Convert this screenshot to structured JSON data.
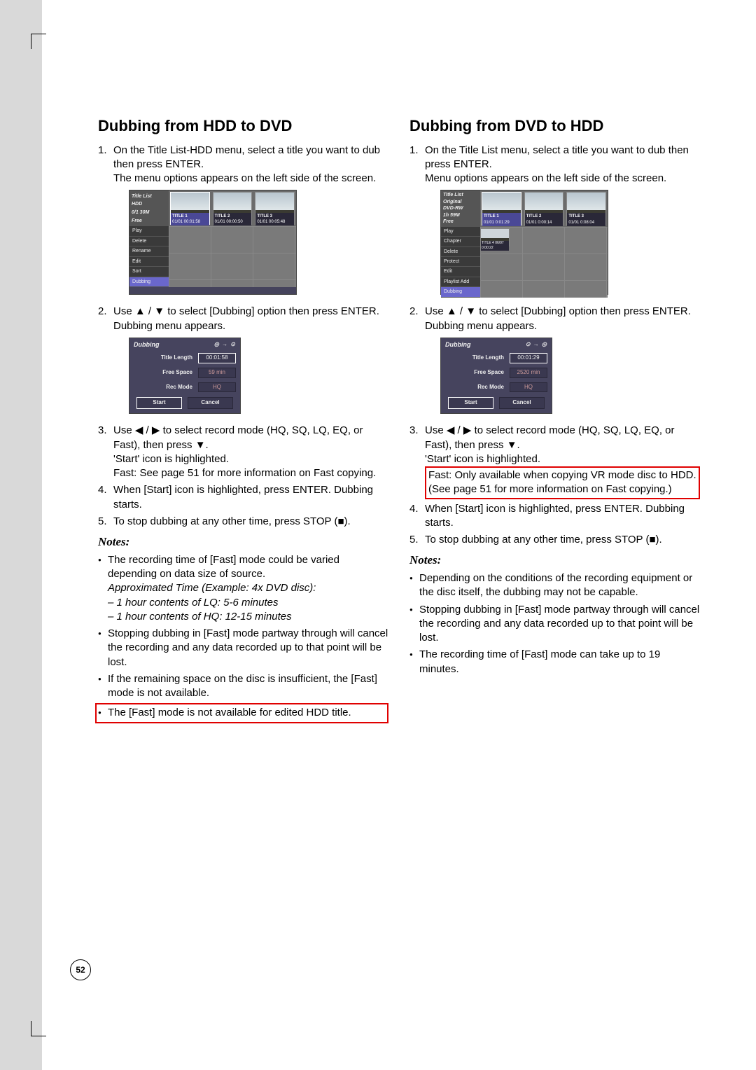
{
  "page_number": "52",
  "left": {
    "heading": "Dubbing from HDD to DVD",
    "step1a": "On the Title List-HDD menu, select a title you want to dub then press ENTER.",
    "step1b": "The menu options appears on the left side of the screen.",
    "fig1": {
      "header_title": "Title List",
      "side_lines": [
        "HDD",
        "0/1 30M",
        "Free"
      ],
      "thumbs": [
        {
          "title": "TITLE 1",
          "meta": "01/01  00:01:58",
          "sel": true
        },
        {
          "title": "TITLE 2",
          "meta": "01/01  00:00:50"
        },
        {
          "title": "TITLE 3",
          "meta": "01/01  00:05:48"
        }
      ],
      "menu": [
        "Play",
        "Delete",
        "Rename",
        "Edit",
        "Sort",
        "Dubbing"
      ]
    },
    "step2a": "Use ▲ / ▼ to select [Dubbing] option then press ENTER.",
    "step2b": "Dubbing menu appears.",
    "fig2": {
      "head": "Dubbing",
      "head_icons": "◎ → ⊙",
      "rows": [
        {
          "label": "Title Length",
          "value": "00:01:58",
          "sel": true
        },
        {
          "label": "Free Space",
          "value": "59 min"
        },
        {
          "label": "Rec Mode",
          "value": "HQ"
        }
      ],
      "start": "Start",
      "cancel": "Cancel"
    },
    "step3a": "Use ◀ / ▶ to select record mode (HQ, SQ, LQ, EQ, or Fast), then press ▼.",
    "step3b": "'Start' icon is highlighted.",
    "step3c": "Fast: See page 51 for more information on Fast copying.",
    "step4": "When [Start] icon is highlighted, press ENTER. Dubbing starts.",
    "step5": "To stop dubbing at any other time, press STOP (■).",
    "notes_h": "Notes:",
    "note1": "The recording time of [Fast] mode could be varied depending on data size of source.",
    "note1_i1": "Approximated Time (Example: 4x DVD disc):",
    "note1_i2": "– 1 hour contents of LQ: 5-6 minutes",
    "note1_i3": "– 1 hour contents of HQ: 12-15 minutes",
    "note2": "Stopping dubbing in [Fast] mode partway through will cancel the recording and any data recorded up to that point will be lost.",
    "note3": "If the remaining space on the disc is insufficient, the [Fast] mode is not available.",
    "note4": "The [Fast] mode is not available for edited HDD title."
  },
  "right": {
    "heading": "Dubbing from DVD to HDD",
    "step1a": "On the Title List menu, select a title you want to dub then press ENTER.",
    "step1b": "Menu options appears on the left side of the screen.",
    "fig1": {
      "header_title": "Title List",
      "side_lines": [
        "Original",
        "DVD-RW",
        "1h 59M",
        "Free"
      ],
      "thumbs": [
        {
          "title": "TITLE 1",
          "meta": "01/01  0:01:29",
          "sel": true
        },
        {
          "title": "TITLE 2",
          "meta": "01/01  0:00:14"
        },
        {
          "title": "TITLE 3",
          "meta": "01/01  0:08:04"
        }
      ],
      "extra": [
        {
          "label": "TITLE 4",
          "meta": "06/07 0:00:22"
        }
      ],
      "menu": [
        "Play",
        "Chapter",
        "Delete",
        "Protect",
        "Edit",
        "Playlist Add",
        "Dubbing"
      ]
    },
    "step2a": "Use ▲ / ▼ to select [Dubbing] option then press ENTER.",
    "step2b": "Dubbing menu appears.",
    "fig2": {
      "head": "Dubbing",
      "head_icons": "⊙ → ◎",
      "rows": [
        {
          "label": "Title Length",
          "value": "00:01:29",
          "sel": true
        },
        {
          "label": "Free Space",
          "value": "2520 min"
        },
        {
          "label": "Rec Mode",
          "value": "HQ"
        }
      ],
      "start": "Start",
      "cancel": "Cancel"
    },
    "step3a": "Use ◀ / ▶ to select record mode  (HQ, SQ, LQ, EQ, or Fast), then press ▼.",
    "step3b": "'Start' icon is highlighted.",
    "step3c": "Fast: Only available when copying VR mode disc to HDD. (See page 51 for more information on Fast copying.)",
    "step4": "When [Start] icon is highlighted, press ENTER. Dubbing starts.",
    "step5": "To stop dubbing at any other time, press STOP (■).",
    "notes_h": "Notes:",
    "note1": "Depending on the conditions of the recording equipment or the disc itself, the dubbing may not be capable.",
    "note2": "Stopping dubbing in [Fast] mode partway through will cancel the recording and any data recorded up to that point will be lost.",
    "note3": "The recording time of [Fast] mode can take up to 19 minutes."
  }
}
